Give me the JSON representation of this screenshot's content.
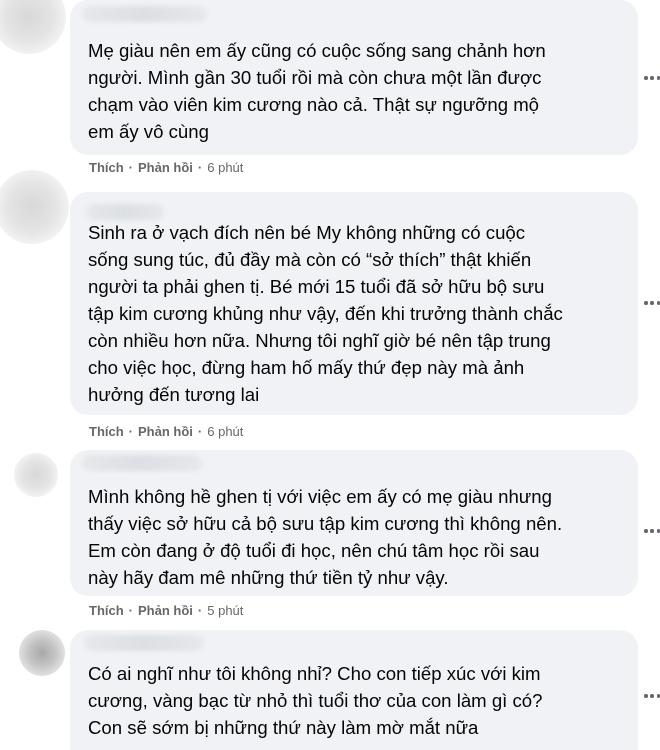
{
  "comments": [
    {
      "text": "Mẹ giàu nên em ấy cũng có cuộc sống sang chảnh hơn\nngười. Mình gần 30 tuổi rồi mà còn chưa một lần được\nchạm vào viên kim cương nào cả. Thật sự ngưỡng mộ\nem ấy vô cùng",
      "like_label": "Thích",
      "reply_label": "Phản hồi",
      "separator": "·",
      "time": "6 phút",
      "more_icon": "more-options-icon"
    },
    {
      "text": "Sinh ra ở vạch đích nên bé My không những có cuộc\nsống sung túc, đủ đầy mà còn có “sở thích” thật khiến\nngười ta phải ghen tị. Bé mới 15 tuổi đã sở hữu bộ sưu\ntập kim cương khủng như vậy, đến khi trưởng thành chắc\ncòn nhiều hơn nữa. Nhưng tôi nghĩ giờ bé nên tập trung\ncho việc học, đừng ham hố mấy thứ đẹp này mà ảnh\nhưởng đến tương lai",
      "like_label": "Thích",
      "reply_label": "Phản hồi",
      "separator": "·",
      "time": "6 phút",
      "more_icon": "more-options-icon"
    },
    {
      "text": "Mình không hề ghen tị với việc em ấy có mẹ giàu nhưng\nthấy việc sở hữu cả bộ sưu tập kim cương thì không nên.\nEm còn đang ở độ tuổi đi học, nên chú tâm học rồi sau\nnày hãy đam mê những thứ tiền tỷ như vậy.",
      "like_label": "Thích",
      "reply_label": "Phản hồi",
      "separator": "·",
      "time": "5 phút",
      "more_icon": "more-options-icon"
    },
    {
      "text": "Có ai nghĩ như tôi không nhỉ? Cho con tiếp xúc với kim\ncương, vàng bạc từ nhỏ thì tuổi thơ của con làm gì có?\nCon sẽ sớm bị những thứ này làm mờ mắt nữa",
      "more_icon": "more-options-icon"
    }
  ],
  "colors": {
    "bubble_bg": "#f0f2f5",
    "text": "#050505",
    "secondary_text": "#65676b"
  }
}
